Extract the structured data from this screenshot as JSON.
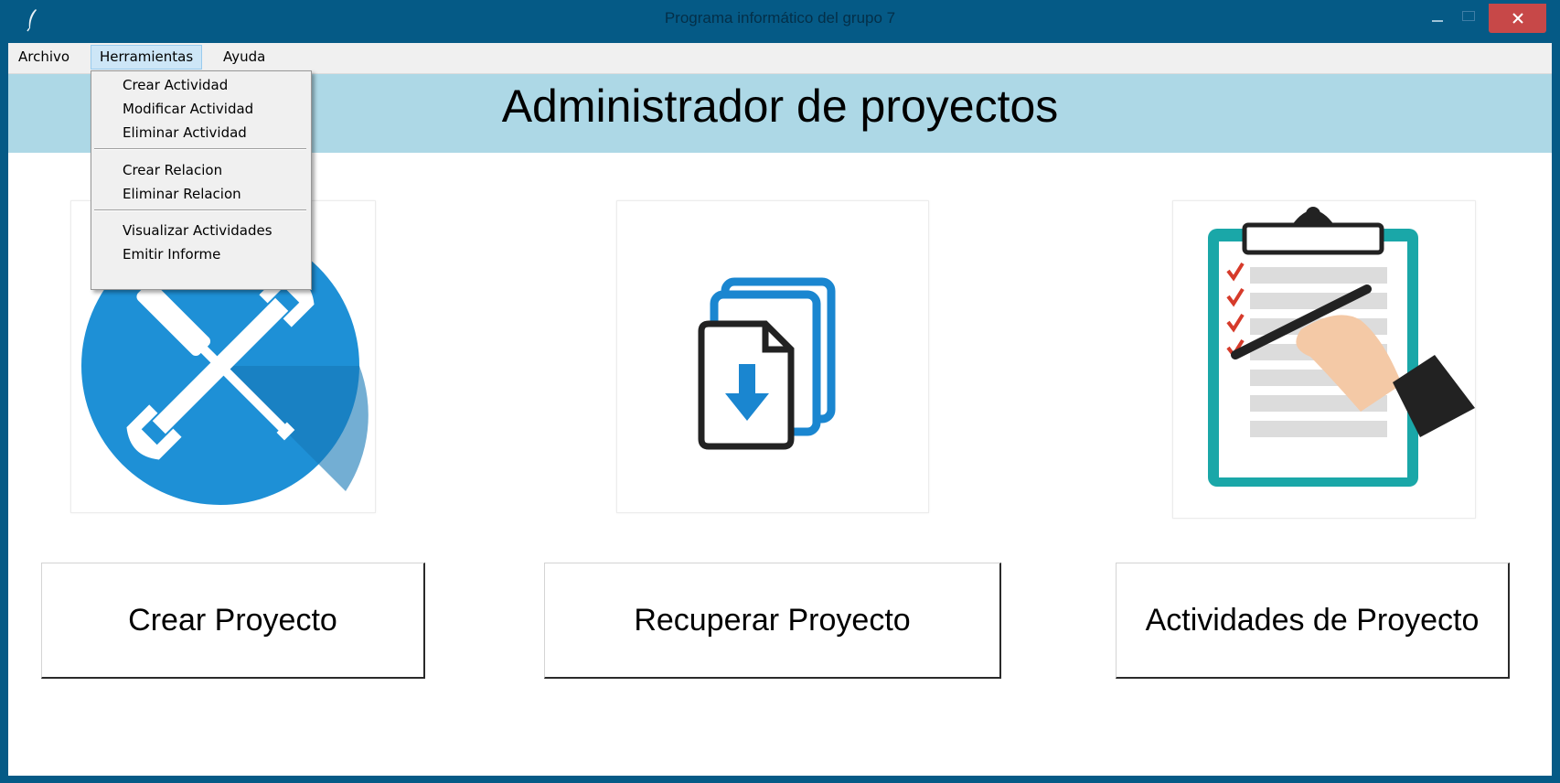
{
  "window": {
    "title": "Programa informático del grupo 7",
    "colors": {
      "frame": "#055a86",
      "close": "#c74848",
      "header_band": "#add8e6"
    }
  },
  "menubar": {
    "items": [
      "Archivo",
      "Herramientas",
      "Ayuda"
    ],
    "open_menu": "Herramientas"
  },
  "dropdown": {
    "items": [
      "Crear Actividad",
      "Modificar Actividad",
      "Eliminar Actividad",
      "Crear Relacion",
      "Eliminar Relacion",
      "Visualizar Actividades",
      "Emitir Informe"
    ]
  },
  "header": {
    "title": "Administrador de proyectos"
  },
  "cards": [
    {
      "icon": "tools-icon",
      "button": "Crear Proyecto"
    },
    {
      "icon": "document-download-icon",
      "button": "Recuperar Proyecto"
    },
    {
      "icon": "clipboard-checklist-icon",
      "button": "Actividades de Proyecto"
    }
  ]
}
